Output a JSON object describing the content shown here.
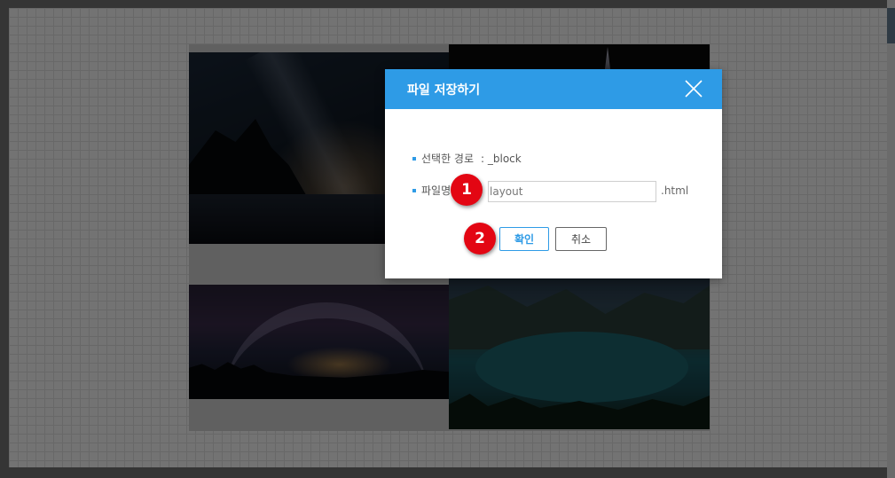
{
  "dialog": {
    "title": "파일 저장하기",
    "path_label": "선택한 경로",
    "path_value": ": _block",
    "filename_label": "파일명",
    "filename_value": "layout",
    "extension": ".html",
    "confirm_label": "확인",
    "cancel_label": "취소"
  },
  "annotations": {
    "step1": "1",
    "step2": "2"
  },
  "icons": {
    "close": "close-icon"
  },
  "colors": {
    "header": "#2e9be6",
    "badge": "#e30613"
  }
}
